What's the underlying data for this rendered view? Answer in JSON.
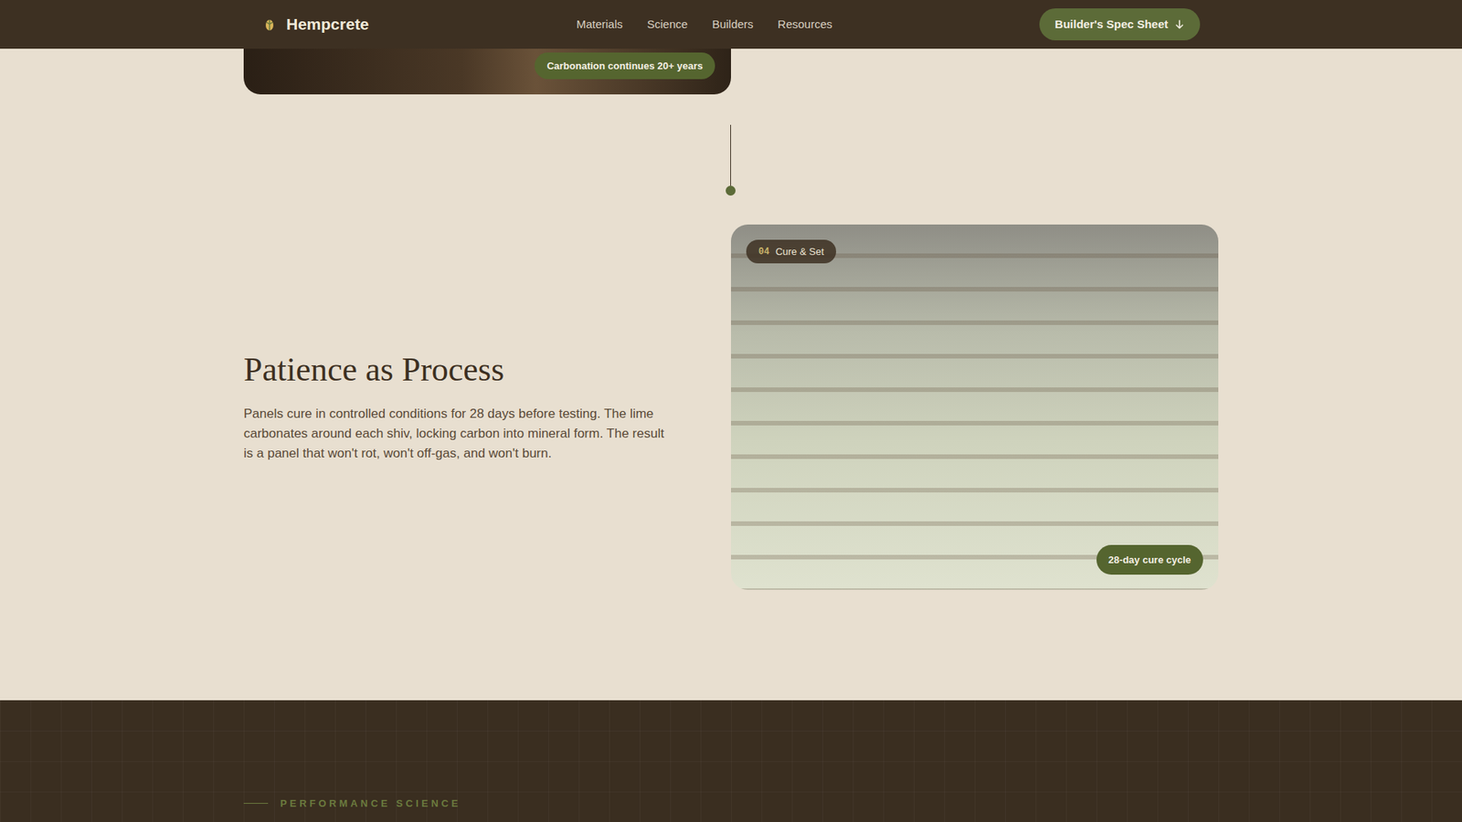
{
  "brand": {
    "name": "Hempcrete"
  },
  "nav": {
    "links": [
      "Materials",
      "Science",
      "Builders",
      "Resources"
    ]
  },
  "cta": {
    "label": "Builder's Spec Sheet"
  },
  "previous_step": {
    "badge": "Carbonation continues 20+ years"
  },
  "step": {
    "number": "04",
    "label": "Cure & Set",
    "title": "Patience as Process",
    "body": "Panels cure in controlled conditions for 28 days before testing. The lime carbonates around each shiv, locking carbon into mineral form. The result is a panel that won't rot, won't off-gas, and won't burn.",
    "badge": "28-day cure cycle"
  },
  "next_section": {
    "eyebrow": "PERFORMANCE SCIENCE"
  }
}
